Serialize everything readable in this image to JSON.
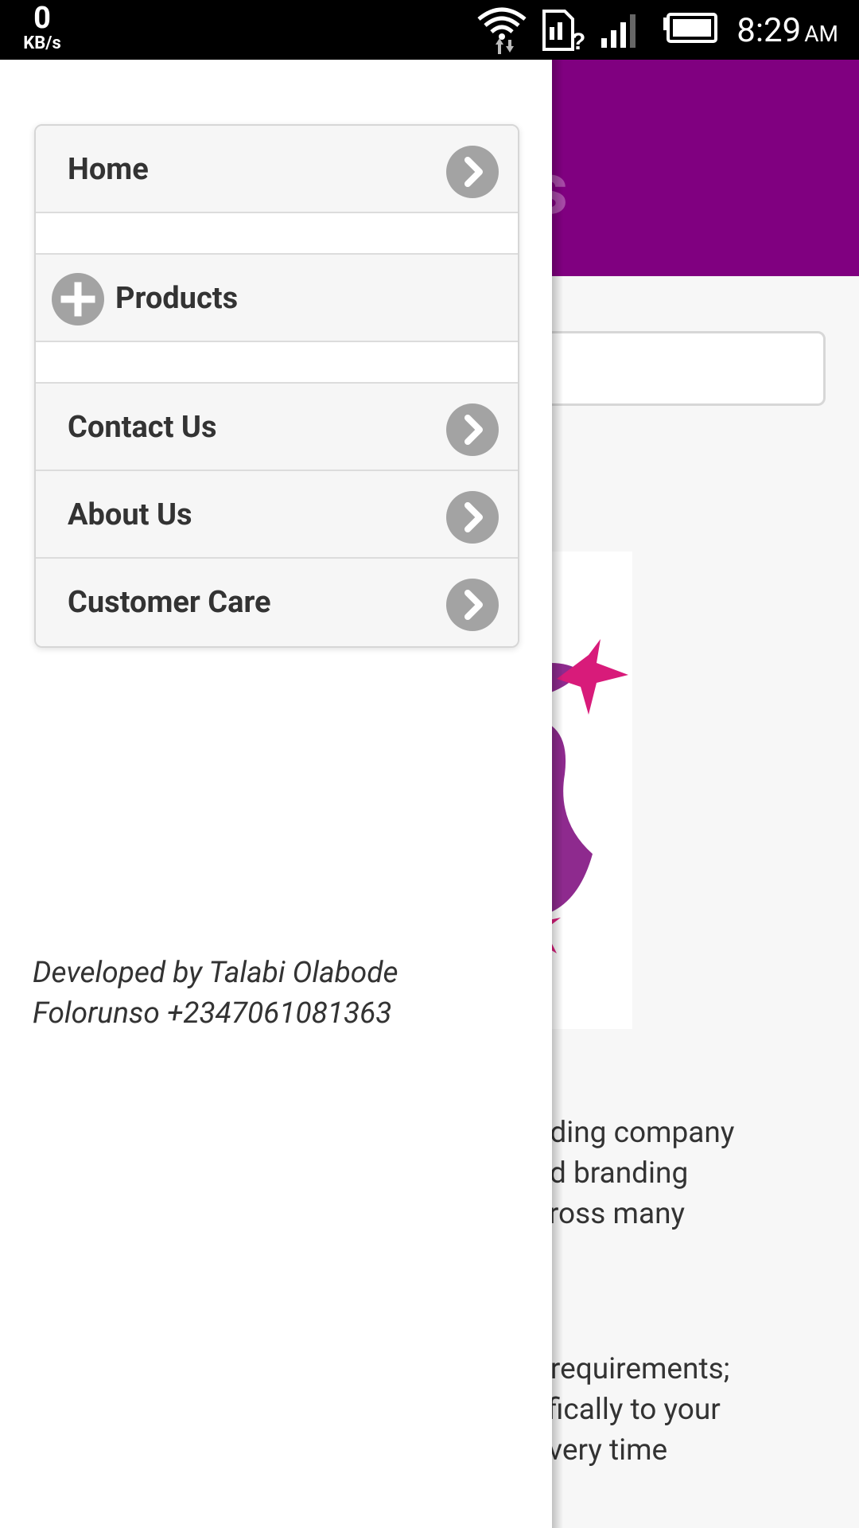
{
  "status_bar": {
    "net_speed_value": "0",
    "net_speed_unit": "KB/s",
    "time": "8:29",
    "ampm": "AM",
    "icons": [
      "wifi-icon",
      "sim-unknown-icon",
      "signal-icon",
      "battery-icon"
    ]
  },
  "background_page": {
    "header_color": "#800080",
    "header_title_fragment": "s",
    "paragraph1": "l branding company\nng and branding\nng across many",
    "paragraph2": "nting requirements;\nspecifically to your\nsult every time"
  },
  "drawer": {
    "menu": [
      {
        "label": "Home",
        "icon": "chevron-right-icon"
      },
      {
        "label": "Products",
        "icon": "plus-icon"
      },
      {
        "label": "Contact Us",
        "icon": "chevron-right-icon"
      },
      {
        "label": "About Us",
        "icon": "chevron-right-icon"
      },
      {
        "label": "Customer Care",
        "icon": "chevron-right-icon"
      }
    ],
    "credit": "Developed by Talabi Olabode Folorunso +2347061081363"
  },
  "colors": {
    "accent": "#800080",
    "logo_pink": "#d81b7a",
    "logo_purple": "#8e2a8e"
  }
}
